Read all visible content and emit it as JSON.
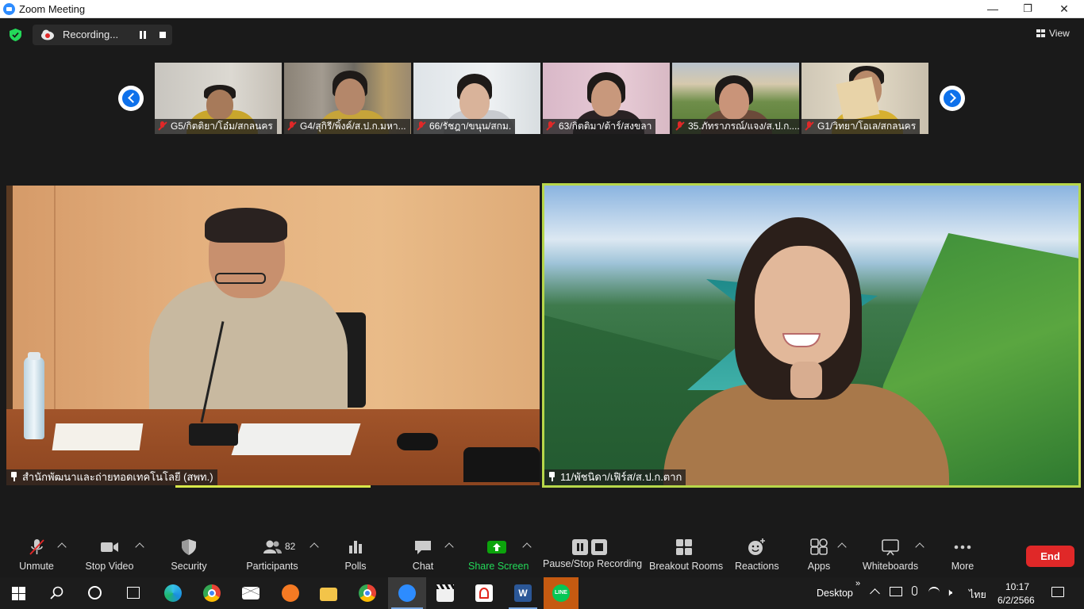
{
  "window": {
    "title": "Zoom Meeting",
    "minimize": "—",
    "maximize": "❐",
    "close": "✕"
  },
  "topbar": {
    "recording_label": "Recording...",
    "view_label": "View"
  },
  "thumbnails": [
    {
      "name": "G5/กิตติยา/โอ๋ม/สกลนคร"
    },
    {
      "name": "G4/สุกิรี/พิ้งค์/ส.ป.ก.มหา..."
    },
    {
      "name": "66/รัชฎา/ขนุน/สกม."
    },
    {
      "name": "63/กิตติมา/ต้าร์/สงขลา"
    },
    {
      "name": "35.ภัทราภรณ์/แจง/ส.ป.ก...."
    },
    {
      "name": "G1/วิทยา/โอเล/สกลนคร"
    }
  ],
  "tiles": {
    "left": {
      "name": "สำนักพัฒนาและถ่ายทอดเทคโนโลยี (สพท.)"
    },
    "right": {
      "name": "11/พัชนิดา/เฟิร์ส/ส.ป.ก.ตาก"
    }
  },
  "toolbar": {
    "unmute": "Unmute",
    "stop_video": "Stop Video",
    "security": "Security",
    "participants": "Participants",
    "participants_count": "82",
    "polls": "Polls",
    "chat": "Chat",
    "share_screen": "Share Screen",
    "pause_stop_recording": "Pause/Stop Recording",
    "breakout_rooms": "Breakout Rooms",
    "reactions": "Reactions",
    "apps": "Apps",
    "whiteboards": "Whiteboards",
    "more": "More",
    "end": "End"
  },
  "taskbar": {
    "desktop_label": "Desktop",
    "language": "ไทย",
    "time": "10:17",
    "date": "6/2/2566"
  },
  "colors": {
    "accent": "#0e71eb",
    "share_green": "#0ca30c",
    "end_red": "#e02828",
    "active_speaker": "#b7d74a"
  }
}
